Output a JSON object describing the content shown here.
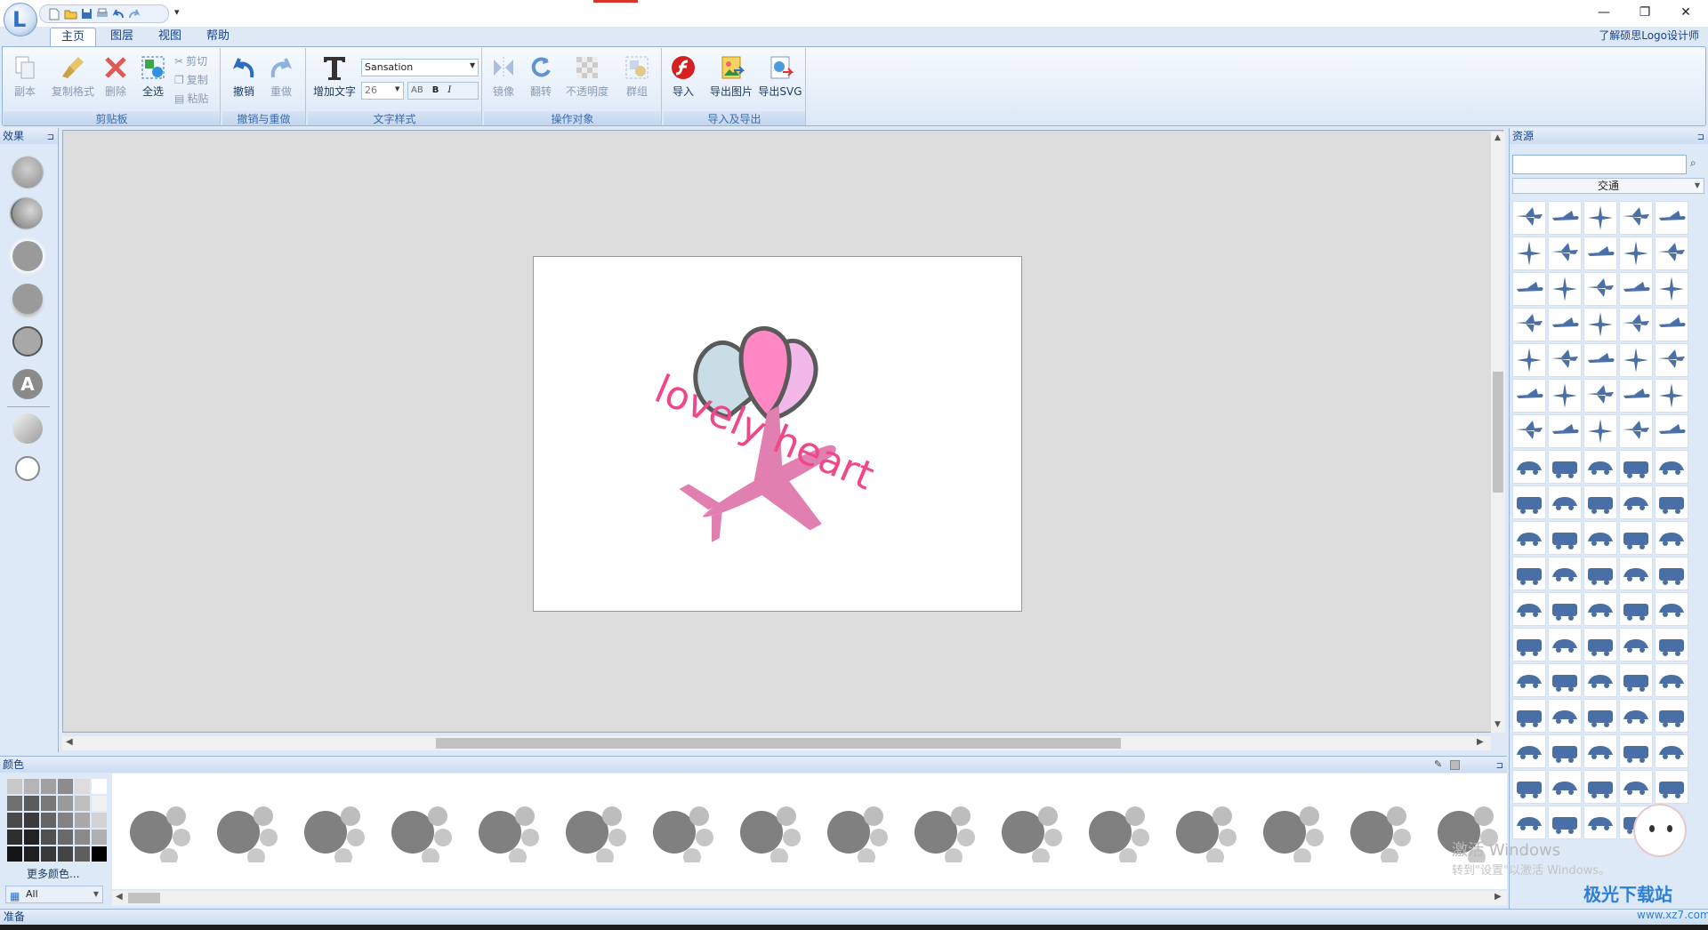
{
  "window": {
    "minimize": "—",
    "restore": "❐",
    "close": "✕"
  },
  "menu": {
    "tabs": [
      "主页",
      "图层",
      "视图",
      "帮助"
    ],
    "help_link": "了解硕思Logo设计师",
    "qat_more": "▾"
  },
  "ribbon": {
    "clipboard": {
      "label": "剪贴板",
      "copy_doc": "副本",
      "format_painter": "复制格式",
      "delete": "删除",
      "select_all": "全选",
      "cut": "剪切",
      "copy": "复制",
      "paste": "粘贴"
    },
    "undo_group": {
      "label": "撤销与重做",
      "undo": "撤销",
      "redo": "重做"
    },
    "text_style": {
      "label": "文字样式",
      "add_text": "增加文字",
      "font": "Sansation",
      "size": "26",
      "spacing": "AB",
      "bold": "B",
      "italic": "I"
    },
    "operate": {
      "label": "操作对象",
      "mirror": "镜像",
      "flip": "翻转",
      "opacity": "不透明度",
      "group": "群组"
    },
    "import_export": {
      "label": "导入及导出",
      "import": "导入",
      "export_image": "导出图片",
      "export_svg": "导出SVG"
    }
  },
  "effects_panel": {
    "title": "效果",
    "pin": "⊐"
  },
  "canvas": {
    "logo_text": "lovely heart",
    "colors": {
      "balloon_left": "#c8dde6",
      "balloon_mid": "#ff87c4",
      "balloon_right": "#f2b8ea",
      "outline": "#5a5a5a",
      "text": "#f0478b",
      "plane": "#e07fb0"
    }
  },
  "color_panel": {
    "title": "颜色",
    "more": "更多颜色...",
    "filter": "All",
    "pin": "⊐"
  },
  "resources": {
    "title": "资源",
    "category": "交通",
    "search_placeholder": "",
    "pin": "⊐",
    "item_count": 89
  },
  "status": {
    "text": "准备"
  },
  "watermark": {
    "line1": "激活 Windows",
    "line2": "转到\"设置\"以激活 Windows。",
    "badge": "极光下载站",
    "url": "www.xz7.com"
  }
}
